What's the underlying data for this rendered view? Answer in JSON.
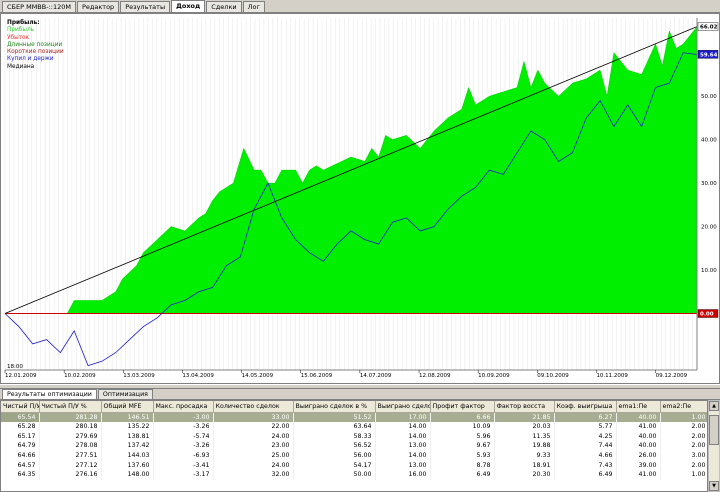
{
  "tabs": [
    {
      "label": "СБЕР MMBB-::120M",
      "active": false
    },
    {
      "label": "Редактор",
      "active": false
    },
    {
      "label": "Результаты",
      "active": false
    },
    {
      "label": "Доход",
      "active": true
    },
    {
      "label": "Сделки",
      "active": false
    },
    {
      "label": "Лог",
      "active": false
    }
  ],
  "legend": {
    "title": "Прибыль:",
    "items": [
      {
        "label": "Прибыль",
        "color": "#33cc33"
      },
      {
        "label": "Убыток",
        "color": "#ff3333"
      },
      {
        "label": "Длинные позиции",
        "color": "#228822"
      },
      {
        "label": "Короткие позиции",
        "color": "#aa2222"
      },
      {
        "label": "Купил и держи",
        "color": "#2222cc"
      },
      {
        "label": "Медиана",
        "color": "#000000"
      }
    ]
  },
  "chart_data": {
    "type": "area",
    "x_ticks": [
      "12.01.2009",
      "10.02.2009",
      "13.03.2009",
      "13.04.2009",
      "14.05.2009",
      "15.06.2009",
      "14.07.2009",
      "12.08.2009",
      "10.09.2009",
      "09.10.2009",
      "10.11.2009",
      "09.12.2009"
    ],
    "x_sub_label": "18:00",
    "y_ticks": [
      10.0,
      20.0,
      30.0,
      40.0,
      50.0,
      60.0
    ],
    "y_range": [
      -13,
      68
    ],
    "markers": [
      {
        "label": "66.02",
        "value": 66.02,
        "bg": "#ffffff",
        "fg": "#000000"
      },
      {
        "label": "59.64",
        "value": 59.64,
        "bg": "#1a1ad0",
        "fg": "#ffffff"
      },
      {
        "label": "0.00",
        "value": 0,
        "bg": "#cc0000",
        "fg": "#ffffff"
      }
    ],
    "series": [
      {
        "name": "Прибыль",
        "x": [
          0,
          0.05,
          0.09,
          0.1,
          0.14,
          0.16,
          0.17,
          0.19,
          0.2,
          0.22,
          0.24,
          0.26,
          0.28,
          0.29,
          0.3,
          0.31,
          0.33,
          0.345,
          0.36,
          0.37,
          0.38,
          0.39,
          0.4,
          0.41,
          0.42,
          0.43,
          0.44,
          0.45,
          0.46,
          0.5,
          0.52,
          0.53,
          0.54,
          0.55,
          0.56,
          0.58,
          0.6,
          0.62,
          0.64,
          0.66,
          0.67,
          0.68,
          0.7,
          0.72,
          0.74,
          0.75,
          0.76,
          0.77,
          0.78,
          0.8,
          0.82,
          0.84,
          0.86,
          0.87,
          0.88,
          0.9,
          0.92,
          0.94,
          0.95,
          0.96,
          0.97,
          0.98,
          0.99,
          1.0
        ],
        "values": [
          0,
          0,
          0,
          3,
          3,
          5,
          8,
          11,
          14,
          17,
          20,
          19,
          22,
          23,
          26,
          28,
          30,
          38,
          33,
          33,
          30,
          30,
          33,
          33,
          33,
          30,
          33,
          34,
          33,
          36,
          35,
          38,
          36,
          41,
          40,
          41,
          38,
          42,
          45,
          47,
          52,
          48,
          50,
          51,
          52,
          58,
          52,
          56,
          53,
          50,
          53,
          54,
          56,
          50,
          60,
          56,
          55,
          62,
          57,
          65,
          61,
          62,
          64,
          66
        ]
      },
      {
        "name": "Купил и держи",
        "x": [
          0,
          0.02,
          0.04,
          0.06,
          0.08,
          0.1,
          0.12,
          0.14,
          0.16,
          0.18,
          0.2,
          0.22,
          0.24,
          0.26,
          0.28,
          0.3,
          0.32,
          0.34,
          0.36,
          0.38,
          0.4,
          0.42,
          0.44,
          0.46,
          0.48,
          0.5,
          0.52,
          0.54,
          0.56,
          0.58,
          0.6,
          0.62,
          0.64,
          0.66,
          0.68,
          0.7,
          0.72,
          0.74,
          0.76,
          0.78,
          0.8,
          0.82,
          0.84,
          0.86,
          0.88,
          0.9,
          0.92,
          0.94,
          0.96,
          0.98,
          1.0
        ],
        "values": [
          0,
          -3,
          -7,
          -6,
          -9,
          -4,
          -12,
          -11,
          -9,
          -6,
          -3,
          -1,
          2,
          3,
          5,
          6,
          11,
          13,
          24,
          30,
          22,
          17,
          14,
          12,
          16,
          19,
          17,
          16,
          21,
          22,
          19,
          20,
          24,
          27,
          29,
          33,
          32,
          37,
          42,
          40,
          35,
          37,
          45,
          49,
          43,
          48,
          43,
          52,
          53,
          60,
          59.6
        ]
      },
      {
        "name": "Медиана",
        "x": [
          0,
          1
        ],
        "values": [
          0,
          66.02
        ]
      }
    ]
  },
  "bottom_tabs": [
    {
      "label": "Результаты оптимизации",
      "active": true
    },
    {
      "label": "Оптимизация",
      "active": false
    }
  ],
  "table": {
    "columns": [
      "Чистый П/У",
      "Чистый П/У %",
      "Общий MFE",
      "Макс. просадка",
      "Количество сделок",
      "Выиграно сделок в %",
      "Выиграно сделок",
      "Профит фактор",
      "Фактор восста",
      "Коэф. выигрыша",
      "ema1:Пе",
      "ema2:Пе"
    ],
    "rows": [
      [
        "65.54",
        "281.28",
        "146.51",
        "-3.00",
        "33.00",
        "51.52",
        "17.00",
        "6.66",
        "21.85",
        "6.27",
        "40.00",
        "1.00"
      ],
      [
        "65.28",
        "280.18",
        "135.22",
        "-3.26",
        "22.00",
        "63.64",
        "14.00",
        "10.09",
        "20.03",
        "5.77",
        "41.00",
        "2.00"
      ],
      [
        "65.17",
        "279.69",
        "138.81",
        "-5.74",
        "24.00",
        "58.33",
        "14.00",
        "5.96",
        "11.35",
        "4.25",
        "40.00",
        "2.00"
      ],
      [
        "64.79",
        "278.08",
        "137.42",
        "-3.26",
        "23.00",
        "56.52",
        "13.00",
        "9.67",
        "19.88",
        "7.44",
        "40.00",
        "2.00"
      ],
      [
        "64.66",
        "277.51",
        "144.03",
        "-6.93",
        "25.00",
        "56.00",
        "14.00",
        "5.93",
        "9.33",
        "4.66",
        "26.00",
        "3.00"
      ],
      [
        "64.57",
        "277.12",
        "137.60",
        "-3.41",
        "24.00",
        "54.17",
        "13.00",
        "8.78",
        "18.91",
        "7.43",
        "39.00",
        "2.00"
      ],
      [
        "64.35",
        "276.16",
        "148.00",
        "-3.17",
        "32.00",
        "50.00",
        "16.00",
        "6.49",
        "20.30",
        "6.49",
        "41.00",
        "1.00"
      ]
    ]
  }
}
